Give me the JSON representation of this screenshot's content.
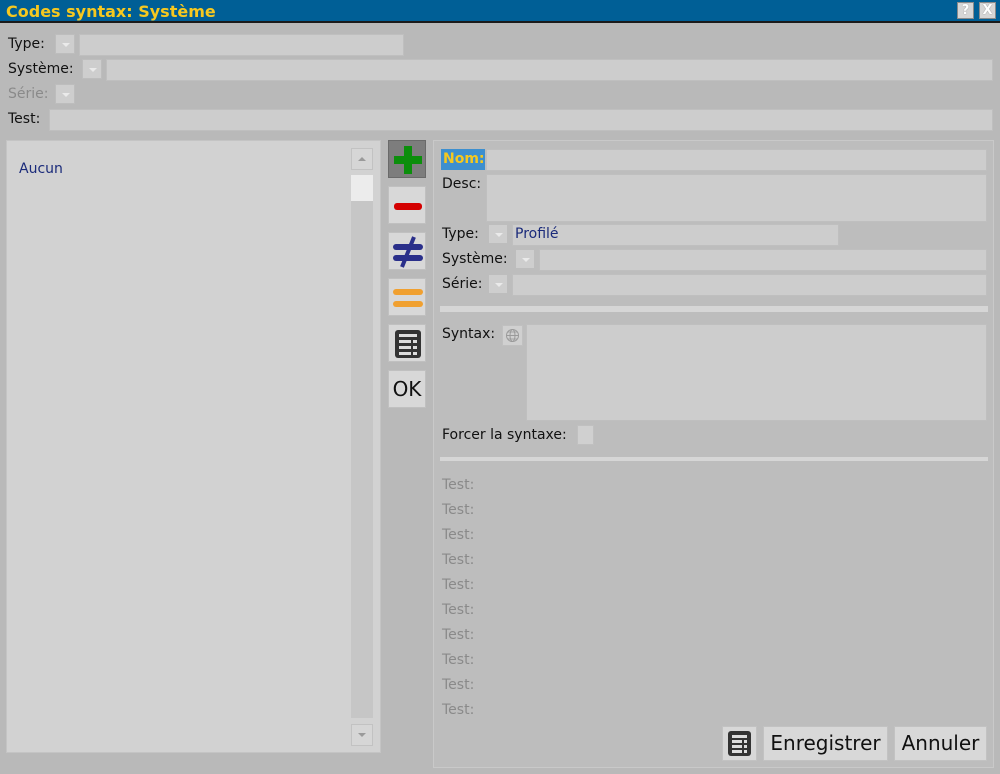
{
  "window": {
    "title": "Codes syntax: Système",
    "help_label": "?",
    "close_label": "X"
  },
  "filters": {
    "type_label": "Type:",
    "systeme_label": "Système:",
    "serie_label": "Série:",
    "test_label": "Test:"
  },
  "list": {
    "items": [
      "Aucun"
    ]
  },
  "toolbar": {
    "ok_label": "OK",
    "add_color": "#0b8e0b",
    "remove_color": "#d40000",
    "notequal_color": "#2a2f8a",
    "equal_color": "#f0a030"
  },
  "form": {
    "nom_label": "Nom:",
    "desc_label": "Desc:",
    "type_label": "Type:",
    "type_value": "Profilé",
    "systeme_label": "Système:",
    "serie_label": "Série:",
    "syntax_label": "Syntax:",
    "forcer_label": "Forcer la syntaxe:",
    "test_labels": [
      "Test:",
      "Test:",
      "Test:",
      "Test:",
      "Test:",
      "Test:",
      "Test:",
      "Test:",
      "Test:",
      "Test:"
    ]
  },
  "footer": {
    "save_label": "Enregistrer",
    "cancel_label": "Annuler"
  }
}
